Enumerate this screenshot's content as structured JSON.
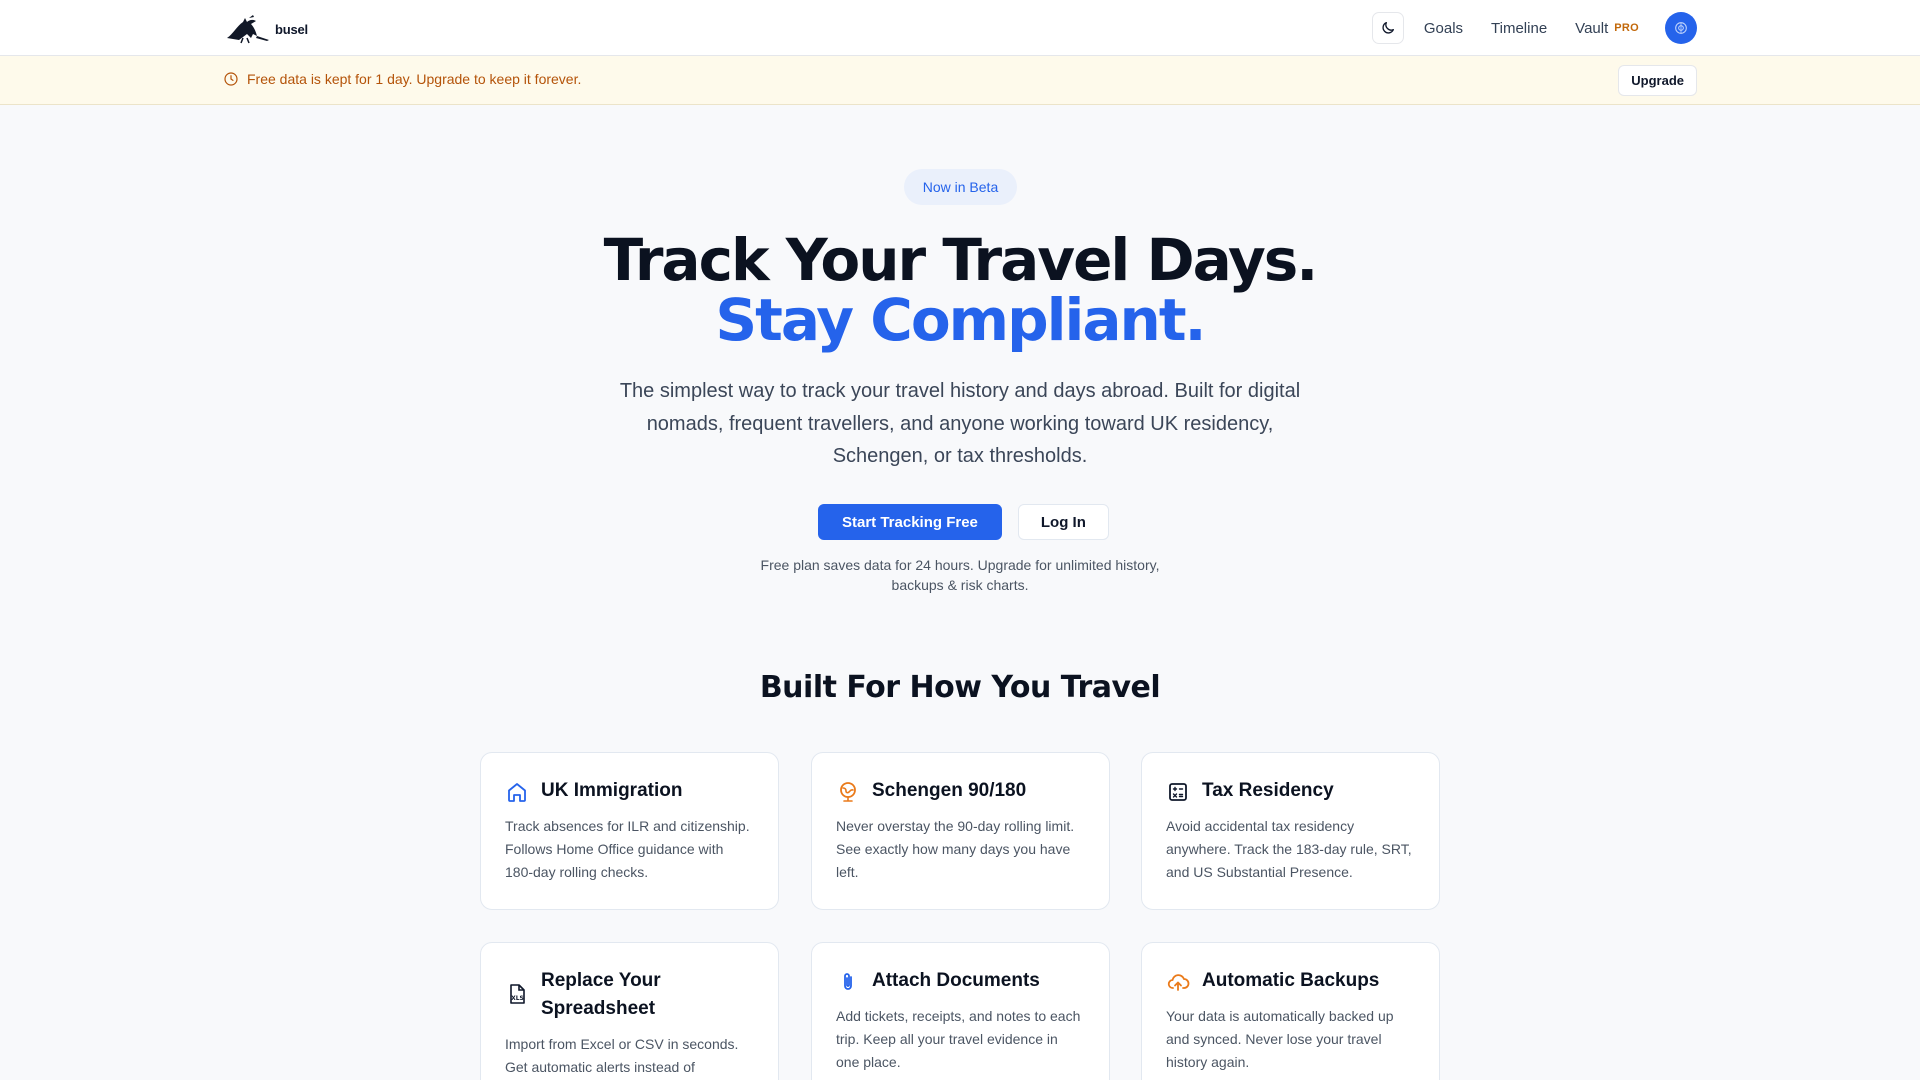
{
  "header": {
    "logo_text": "busel",
    "nav": {
      "goals": "Goals",
      "timeline": "Timeline",
      "vault": "Vault",
      "vault_badge": "PRO"
    }
  },
  "banner": {
    "message": "Free data is kept for 1 day. Upgrade to keep it forever.",
    "upgrade_label": "Upgrade"
  },
  "hero": {
    "badge": "Now in Beta",
    "title_line1": "Track Your Travel Days.",
    "title_line2": "Stay Compliant.",
    "lead": "The simplest way to track your travel history and days abroad. Built for digital nomads, frequent travellers, and anyone working toward UK residency, Schengen, or tax thresholds.",
    "primary_cta": "Start Tracking Free",
    "secondary_cta": "Log In",
    "fine_print": "Free plan saves data for 24 hours. Upgrade for unlimited history, backups & risk charts."
  },
  "features": {
    "heading": "Built For How You Travel",
    "cards": [
      {
        "icon": "home-icon",
        "title": "UK Immigration",
        "desc": "Track absences for ILR and citizenship. Follows Home Office guidance with 180-day rolling checks."
      },
      {
        "icon": "globe-icon",
        "title": "Schengen 90/180",
        "desc": "Never overstay the 90-day rolling limit. See exactly how many days you have left."
      },
      {
        "icon": "calculator-icon",
        "title": "Tax Residency",
        "desc": "Avoid accidental tax residency anywhere. Track the 183-day rule, SRT, and US Substantial Presence."
      },
      {
        "icon": "spreadsheet-file-icon",
        "title": "Replace Your Spreadsheet",
        "desc": "Import from Excel or CSV in seconds. Get automatic alerts instead of"
      },
      {
        "icon": "paperclip-icon",
        "title": "Attach Documents",
        "desc": "Add tickets, receipts, and notes to each trip. Keep all your travel evidence in one place."
      },
      {
        "icon": "cloud-upload-icon",
        "title": "Automatic Backups",
        "desc": "Your data is automatically backed up and synced. Never lose your travel history again."
      }
    ]
  },
  "colors": {
    "accent": "#2563eb",
    "warning": "#b45309",
    "pro_badge": "#c2680a"
  }
}
